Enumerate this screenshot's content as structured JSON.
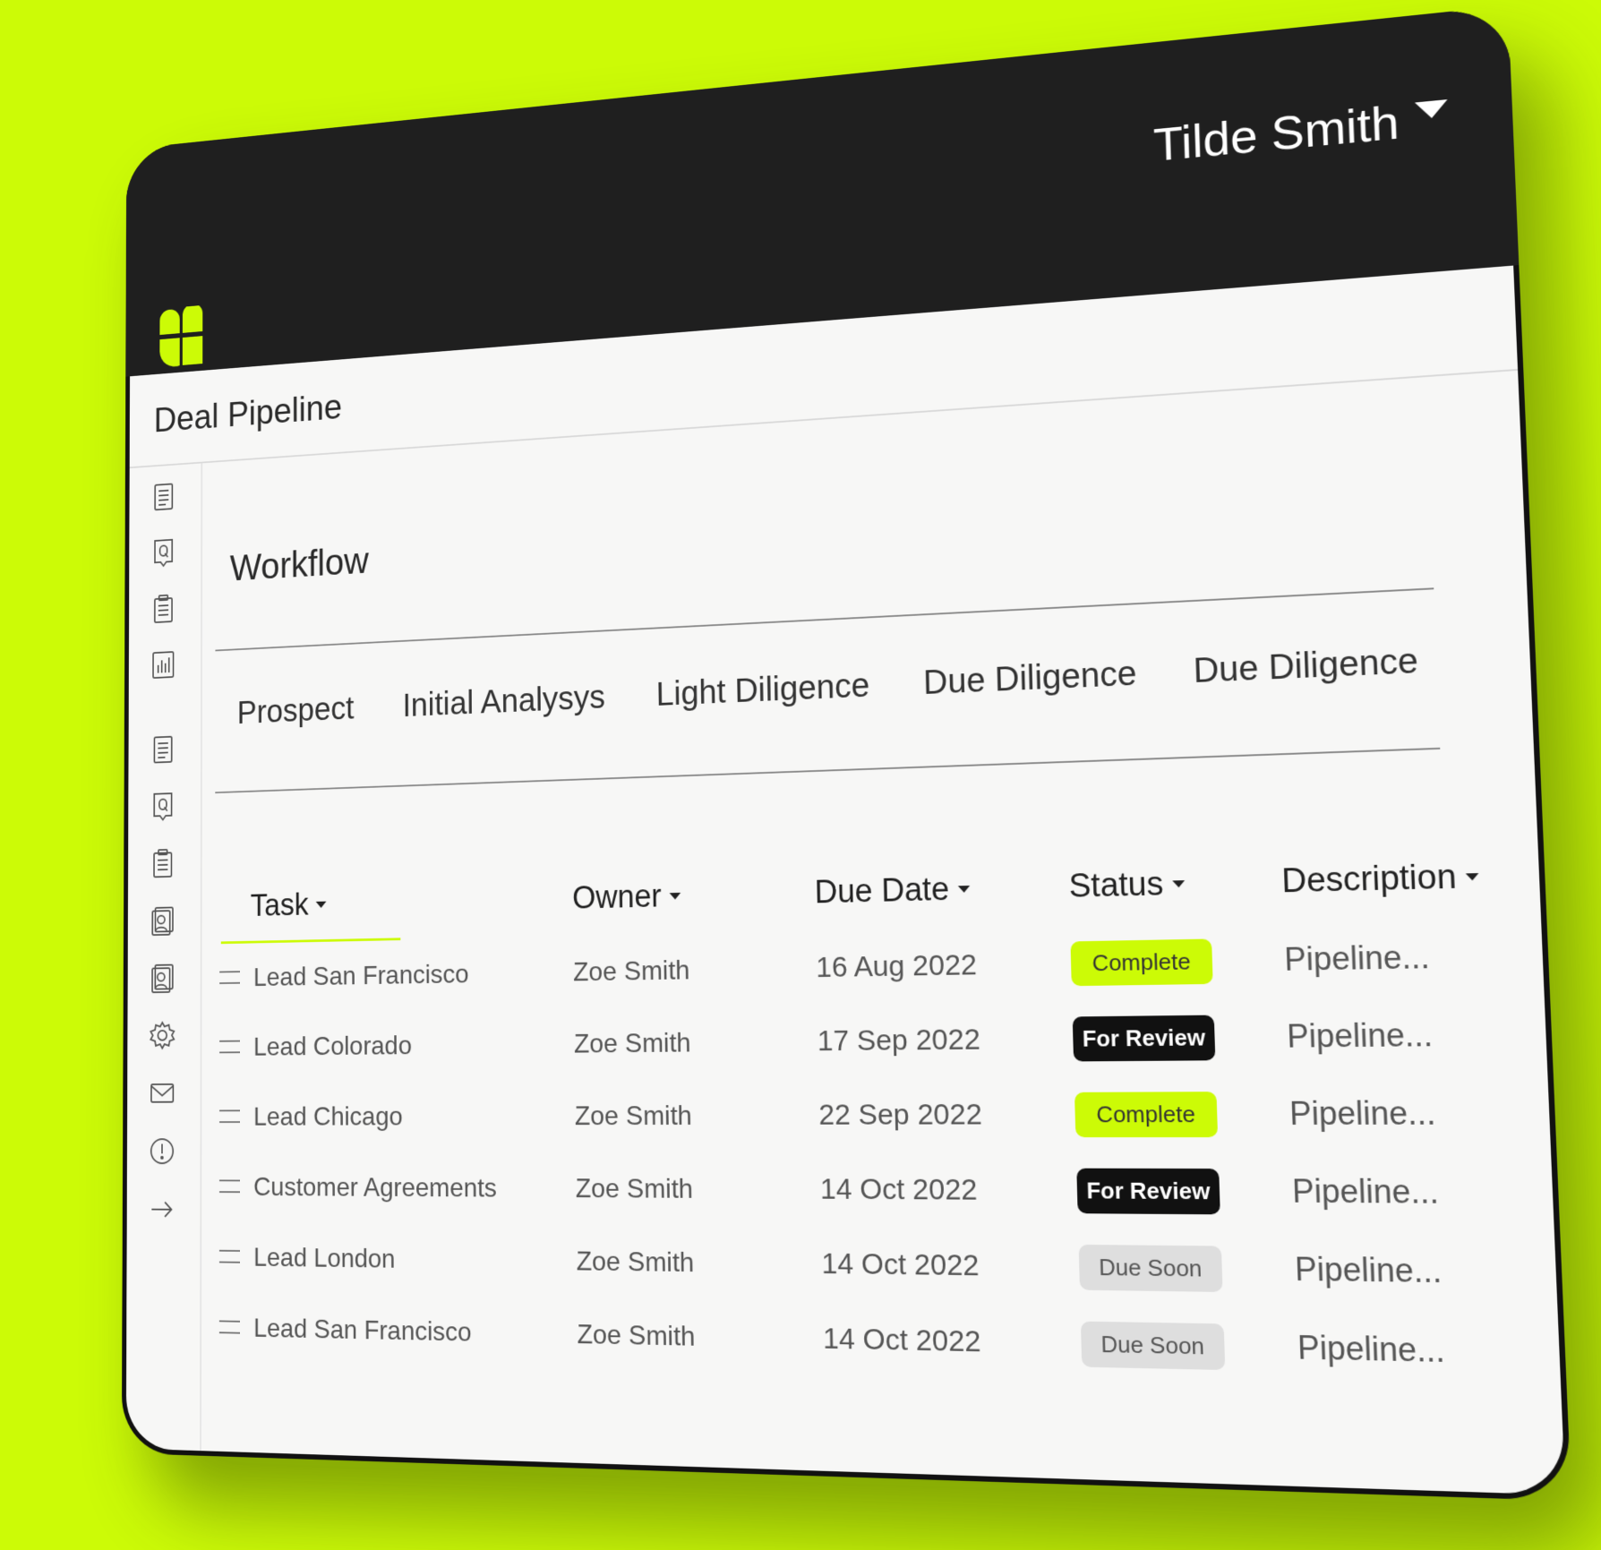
{
  "header": {
    "user_name": "Tilde Smith"
  },
  "page": {
    "title": "Deal Pipeline"
  },
  "sidebar": {
    "icons": [
      "document-icon",
      "quote-doc-icon",
      "clipboard-icon",
      "bar-chart-icon",
      "document-icon",
      "quote-doc-icon",
      "clipboard-icon",
      "contact-card-icon",
      "contact-card-icon",
      "gear-icon",
      "mail-icon",
      "alert-icon",
      "arrow-right-icon"
    ]
  },
  "workflow": {
    "title": "Workflow",
    "stages": [
      "Prospect",
      "Initial Analysys",
      "Light Diligence",
      "Due Diligence",
      "Due Diligence"
    ]
  },
  "table": {
    "columns": [
      "Task",
      "Owner",
      "Due Date",
      "Status",
      "Description"
    ],
    "rows": [
      {
        "task": "Lead San Francisco",
        "owner": "Zoe Smith",
        "due": "16 Aug 2022",
        "status": "Complete",
        "description": "Pipeline..."
      },
      {
        "task": "Lead Colorado",
        "owner": "Zoe Smith",
        "due": "17 Sep 2022",
        "status": "For Review",
        "description": "Pipeline..."
      },
      {
        "task": "Lead Chicago",
        "owner": "Zoe Smith",
        "due": "22 Sep 2022",
        "status": "Complete",
        "description": "Pipeline..."
      },
      {
        "task": "Customer Agreements",
        "owner": "Zoe Smith",
        "due": "14 Oct 2022",
        "status": "For Review",
        "description": "Pipeline..."
      },
      {
        "task": "Lead London",
        "owner": "Zoe Smith",
        "due": "14 Oct 2022",
        "status": "Due Soon",
        "description": "Pipeline..."
      },
      {
        "task": "Lead San Francisco",
        "owner": "Zoe Smith",
        "due": "14 Oct 2022",
        "status": "Due Soon",
        "description": "Pipeline..."
      }
    ]
  },
  "colors": {
    "accent": "#ccfb06",
    "header_bg": "#1f1f1f",
    "screen_bg": "#f7f7f6",
    "review_badge": "#111111",
    "soon_badge": "#dedede"
  }
}
